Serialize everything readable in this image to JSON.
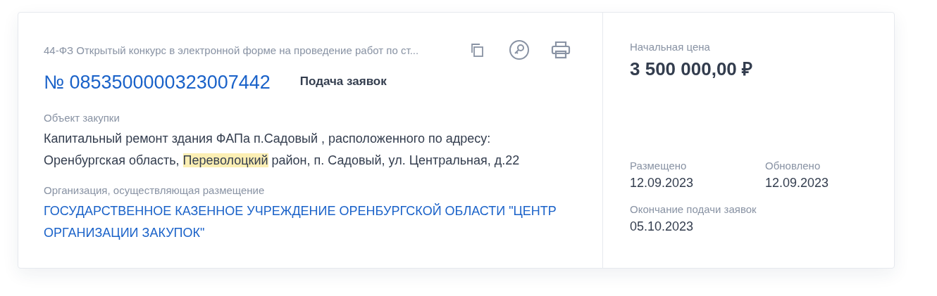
{
  "procurement": {
    "type_line": "44-ФЗ Открытый конкурс в электронной форме на проведение работ по ст...",
    "number": "№ 0853500000323007442",
    "stage": "Подача заявок",
    "object_label": "Объект закупки",
    "object_parts": [
      {
        "text": "Капитальный ремонт здания ФАПа п.Садовый , расположенного по адресу: Оренбургская область, ",
        "highlighted": false
      },
      {
        "text": "Переволоцкий",
        "highlighted": true
      },
      {
        "text": " район, п. Садовый, ул. Центральная, д.22",
        "highlighted": false
      }
    ],
    "org_label": "Организация, осуществляющая размещение",
    "org_name": "ГОСУДАРСТВЕННОЕ КАЗЕННОЕ УЧРЕЖДЕНИЕ ОРЕНБУРГСКОЙ ОБЛАСТИ \"ЦЕНТР ОРГАНИЗАЦИИ ЗАКУПОК\""
  },
  "summary": {
    "price_label": "Начальная цена",
    "price": "3 500 000,00 ₽",
    "dates": [
      {
        "label": "Размещено",
        "value": "12.09.2023"
      },
      {
        "label": "Обновлено",
        "value": "12.09.2023"
      }
    ],
    "deadline_label": "Окончание подачи заявок",
    "deadline": "05.10.2023"
  }
}
